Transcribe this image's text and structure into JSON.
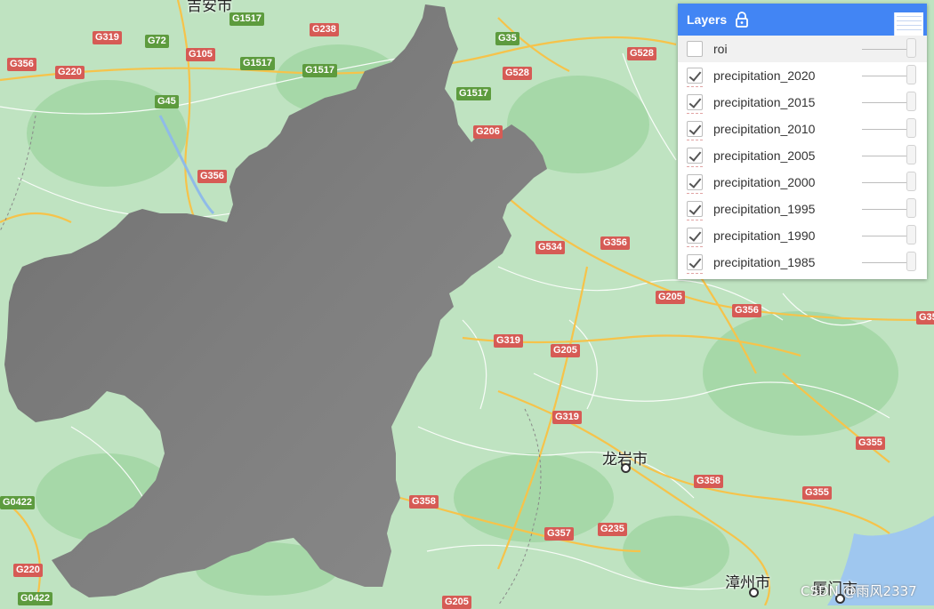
{
  "map": {
    "road_shields": [
      {
        "label": "G1517",
        "color": "green"
      },
      {
        "label": "G319",
        "color": "red"
      },
      {
        "label": "G72",
        "color": "green"
      },
      {
        "label": "G238",
        "color": "red"
      },
      {
        "label": "G35",
        "color": "green"
      },
      {
        "label": "G356",
        "color": "red"
      },
      {
        "label": "G220",
        "color": "red"
      },
      {
        "label": "G105",
        "color": "red"
      },
      {
        "label": "G1517",
        "color": "green"
      },
      {
        "label": "G1517",
        "color": "green"
      },
      {
        "label": "G528",
        "color": "red"
      },
      {
        "label": "G528",
        "color": "red"
      },
      {
        "label": "G45",
        "color": "green"
      },
      {
        "label": "G1517",
        "color": "green"
      },
      {
        "label": "G206",
        "color": "red"
      },
      {
        "label": "G356",
        "color": "red"
      },
      {
        "label": "G534",
        "color": "red"
      },
      {
        "label": "G356",
        "color": "red"
      },
      {
        "label": "G205",
        "color": "red"
      },
      {
        "label": "G356",
        "color": "red"
      },
      {
        "label": "G35",
        "color": "red"
      },
      {
        "label": "G319",
        "color": "red"
      },
      {
        "label": "G205",
        "color": "red"
      },
      {
        "label": "G319",
        "color": "red"
      },
      {
        "label": "G355",
        "color": "red"
      },
      {
        "label": "G358",
        "color": "red"
      },
      {
        "label": "G355",
        "color": "red"
      },
      {
        "label": "G358",
        "color": "red"
      },
      {
        "label": "G357",
        "color": "red"
      },
      {
        "label": "G235",
        "color": "red"
      },
      {
        "label": "G0422",
        "color": "green"
      },
      {
        "label": "G220",
        "color": "red"
      },
      {
        "label": "G0422",
        "color": "green"
      },
      {
        "label": "G205",
        "color": "red"
      }
    ],
    "cities": {
      "longyan": "龙岩市",
      "zhangzhou": "漳州市",
      "xiamen": "厦门市",
      "top_city": "吉安市"
    },
    "watermark": "CSDN @雨风2337",
    "colors": {
      "land": "#bfe3c1",
      "forest": "#a5d6a7",
      "road": "#f6c34a",
      "region": "#7a7a7a"
    }
  },
  "layers_panel": {
    "title": "Layers",
    "lock_icon": "lock-icon",
    "layers": [
      {
        "name": "roi",
        "checked": false
      },
      {
        "name": "precipitation_2020",
        "checked": true
      },
      {
        "name": "precipitation_2015",
        "checked": true
      },
      {
        "name": "precipitation_2010",
        "checked": true
      },
      {
        "name": "precipitation_2005",
        "checked": true
      },
      {
        "name": "precipitation_2000",
        "checked": true
      },
      {
        "name": "precipitation_1995",
        "checked": true
      },
      {
        "name": "precipitation_1990",
        "checked": true
      },
      {
        "name": "precipitation_1985",
        "checked": true
      }
    ]
  }
}
